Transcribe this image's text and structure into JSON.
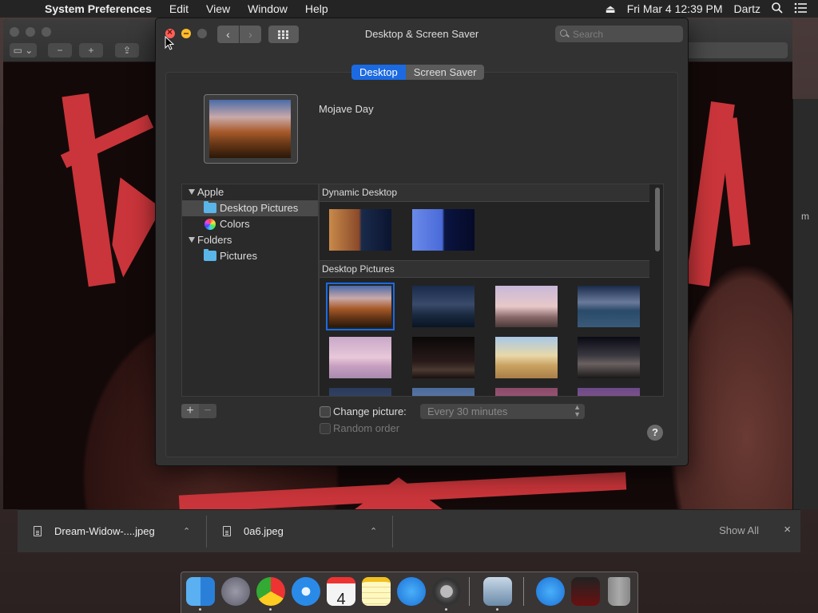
{
  "menubar": {
    "app_name": "System Preferences",
    "items": [
      "Edit",
      "View",
      "Window",
      "Help"
    ],
    "clock": "Fri Mar 4  12:39 PM",
    "user": "Dartz"
  },
  "window": {
    "title": "Desktop & Screen Saver",
    "search_placeholder": "Search"
  },
  "tabs": [
    {
      "label": "Desktop",
      "active": true
    },
    {
      "label": "Screen Saver",
      "active": false
    }
  ],
  "current_picture": {
    "name": "Mojave Day"
  },
  "sidebar": {
    "groups": [
      {
        "label": "Apple",
        "items": [
          {
            "label": "Desktop Pictures",
            "icon": "folder-icon",
            "selected": true
          },
          {
            "label": "Colors",
            "icon": "color-wheel-icon",
            "selected": false
          }
        ]
      },
      {
        "label": "Folders",
        "items": [
          {
            "label": "Pictures",
            "icon": "folder-icon",
            "selected": false
          }
        ]
      }
    ]
  },
  "sections": {
    "dynamic": "Dynamic Desktop",
    "pictures": "Desktop Pictures"
  },
  "controls": {
    "add_symbol": "+",
    "remove_symbol": "−",
    "change_picture_label": "Change picture:",
    "interval_value": "Every 30 minutes",
    "random_order_label": "Random order",
    "help_symbol": "?"
  },
  "downloads": {
    "items": [
      {
        "name": "Dream-Widow-....jpeg"
      },
      {
        "name": "0a6.jpeg"
      }
    ],
    "show_all": "Show All",
    "close_symbol": "×"
  },
  "colors": {
    "accent": "#1b6ae2",
    "close_red": "#fe5f57",
    "minimize_yellow": "#febc2e",
    "art_red": "#c9353a"
  }
}
